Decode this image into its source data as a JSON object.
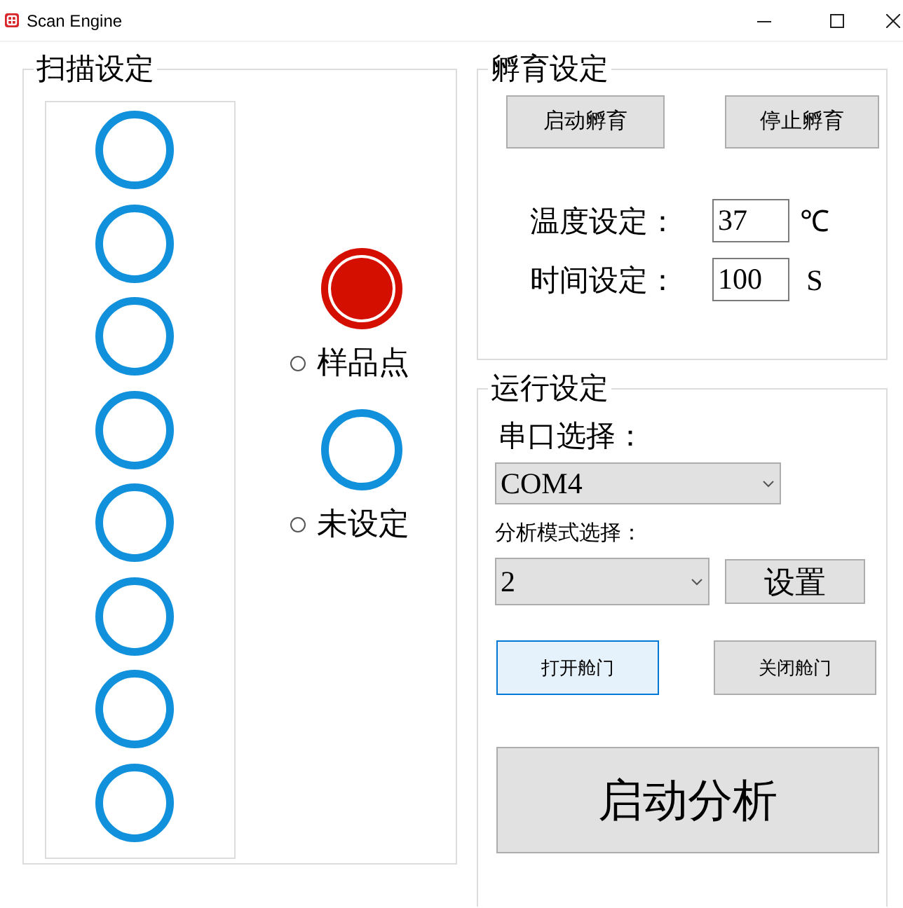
{
  "window": {
    "title": "Scan Engine"
  },
  "scan_settings": {
    "title": "扫描设定",
    "slots": [
      {
        "kind": "unset"
      },
      {
        "kind": "unset"
      },
      {
        "kind": "unset"
      },
      {
        "kind": "unset"
      },
      {
        "kind": "unset"
      },
      {
        "kind": "unset"
      },
      {
        "kind": "unset"
      },
      {
        "kind": "unset"
      }
    ],
    "legend": [
      {
        "kind": "sample",
        "label": "样品点",
        "selected": false
      },
      {
        "kind": "unset",
        "label": "未设定",
        "selected": false
      }
    ]
  },
  "incubation_settings": {
    "title": "孵育设定",
    "buttons": [
      "启动孵育",
      "停止孵育"
    ],
    "fields": [
      {
        "label": "温度设定：",
        "value": "37",
        "unit": "℃"
      },
      {
        "label": "时间设定：",
        "value": "100",
        "unit": "S"
      }
    ]
  },
  "run_settings": {
    "title": "运行设定",
    "port": {
      "label": "串口选择：",
      "value": "COM4"
    },
    "mode": {
      "label": "分析模式选择：",
      "value": "2"
    },
    "set_button": "设置",
    "door_buttons": [
      {
        "label": "打开舱门",
        "focused": true
      },
      {
        "label": "关闭舱门",
        "focused": false
      }
    ],
    "start_button": "启动分析"
  }
}
